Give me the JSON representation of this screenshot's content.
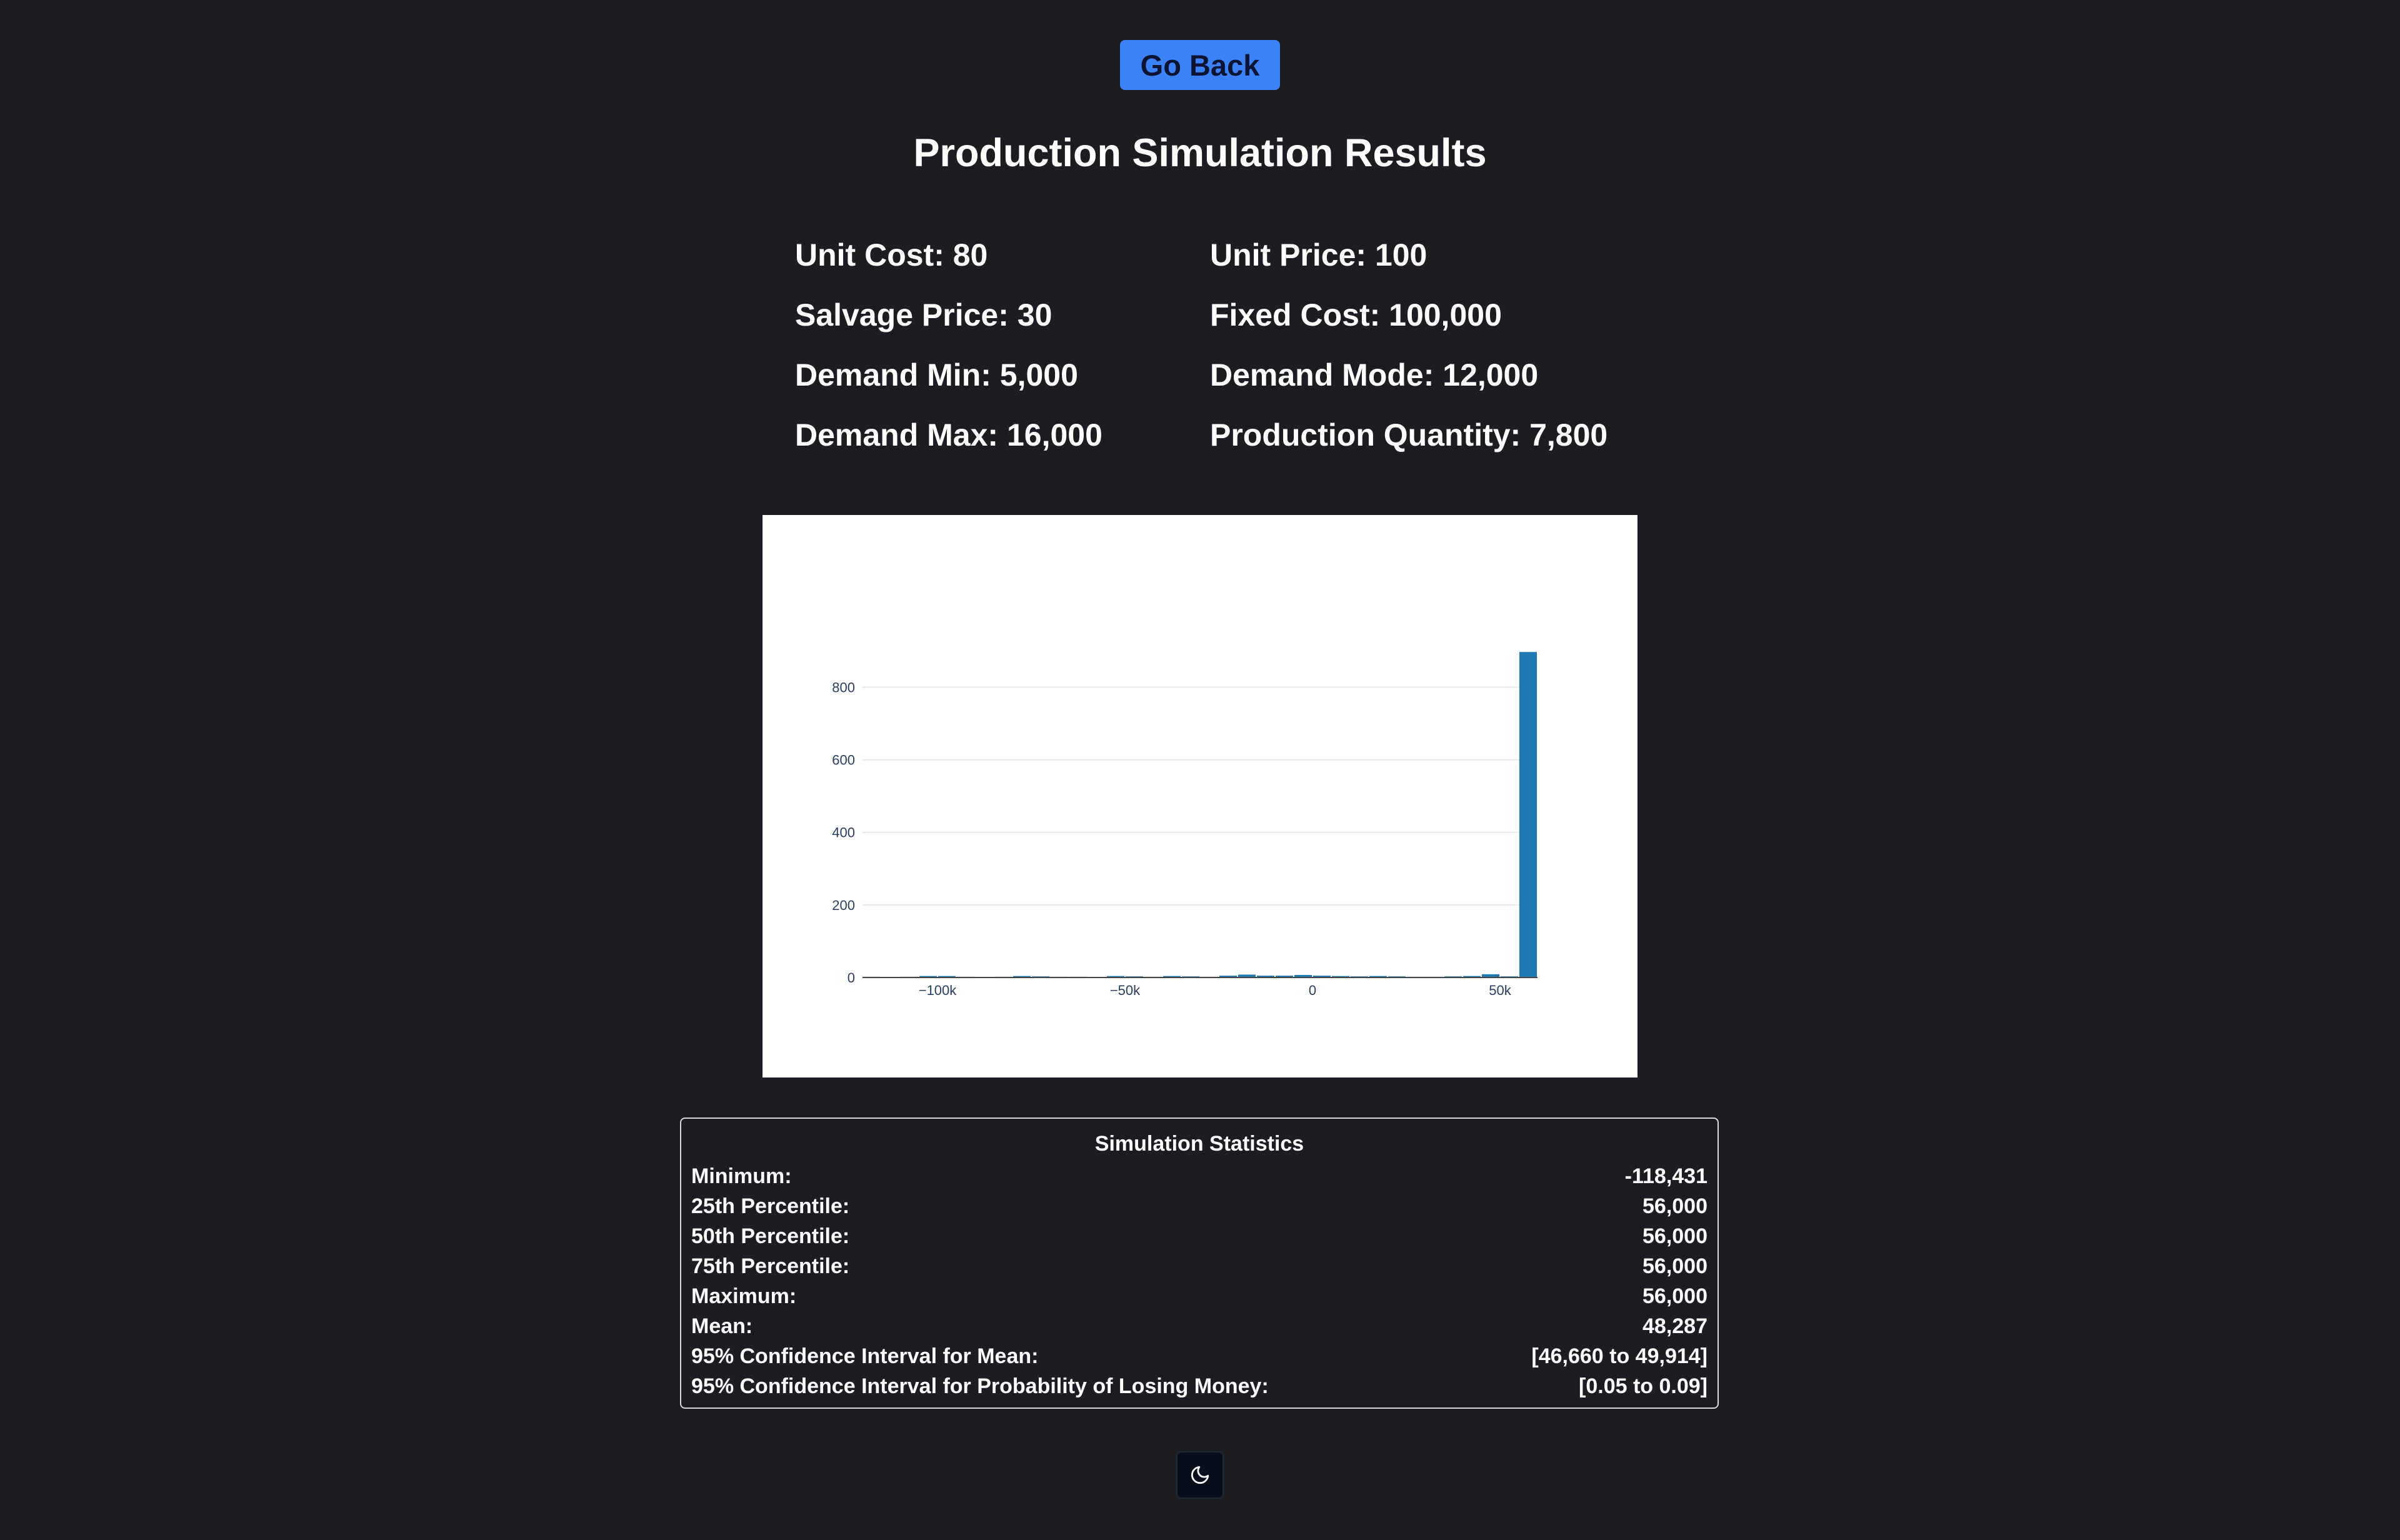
{
  "header": {
    "back_label": "Go Back"
  },
  "page_title": "Production Simulation Results",
  "params": [
    {
      "label": "Unit Cost: 80"
    },
    {
      "label": "Unit Price: 100"
    },
    {
      "label": "Salvage Price: 30"
    },
    {
      "label": "Fixed Cost: 100,000"
    },
    {
      "label": "Demand Min: 5,000"
    },
    {
      "label": "Demand Mode: 12,000"
    },
    {
      "label": "Demand Max: 16,000"
    },
    {
      "label": "Production Quantity: 7,800"
    }
  ],
  "chart_data": {
    "type": "bar",
    "title": "",
    "xlabel": "",
    "ylabel": "",
    "bar_color": "#1f77b4",
    "grid": true,
    "xlim": [
      -120000,
      60000
    ],
    "ylim": [
      0,
      930
    ],
    "x_ticks": [
      -100000,
      -50000,
      0,
      50000
    ],
    "x_tick_labels": [
      "−100k",
      "−50k",
      "0",
      "50k"
    ],
    "y_ticks": [
      0,
      200,
      400,
      600,
      800
    ],
    "y_tick_labels": [
      "0",
      "200",
      "400",
      "600",
      "800"
    ],
    "bin_width": 5000,
    "bins": [
      {
        "x": -117500,
        "y": 2
      },
      {
        "x": -112500,
        "y": 1
      },
      {
        "x": -107500,
        "y": 2
      },
      {
        "x": -102500,
        "y": 4
      },
      {
        "x": -97500,
        "y": 4
      },
      {
        "x": -92500,
        "y": 2
      },
      {
        "x": -87500,
        "y": 1
      },
      {
        "x": -82500,
        "y": 2
      },
      {
        "x": -77500,
        "y": 4
      },
      {
        "x": -72500,
        "y": 3
      },
      {
        "x": -67500,
        "y": 2
      },
      {
        "x": -62500,
        "y": 2
      },
      {
        "x": -57500,
        "y": 1
      },
      {
        "x": -52500,
        "y": 4
      },
      {
        "x": -47500,
        "y": 3
      },
      {
        "x": -42500,
        "y": 2
      },
      {
        "x": -37500,
        "y": 4
      },
      {
        "x": -32500,
        "y": 3
      },
      {
        "x": -27500,
        "y": 2
      },
      {
        "x": -22500,
        "y": 5
      },
      {
        "x": -17500,
        "y": 8
      },
      {
        "x": -12500,
        "y": 5
      },
      {
        "x": -7500,
        "y": 5
      },
      {
        "x": -2500,
        "y": 7
      },
      {
        "x": 2500,
        "y": 5
      },
      {
        "x": 7500,
        "y": 4
      },
      {
        "x": 12500,
        "y": 3
      },
      {
        "x": 17500,
        "y": 4
      },
      {
        "x": 22500,
        "y": 3
      },
      {
        "x": 27500,
        "y": 2
      },
      {
        "x": 32500,
        "y": 2
      },
      {
        "x": 37500,
        "y": 3
      },
      {
        "x": 42500,
        "y": 4
      },
      {
        "x": 47500,
        "y": 9
      },
      {
        "x": 52500,
        "y": 3
      },
      {
        "x": 57500,
        "y": 897
      }
    ]
  },
  "stats": {
    "title": "Simulation Statistics",
    "rows": [
      {
        "label": "Minimum:",
        "value": "-118,431"
      },
      {
        "label": "25th Percentile:",
        "value": "56,000"
      },
      {
        "label": "50th Percentile:",
        "value": "56,000"
      },
      {
        "label": "75th Percentile:",
        "value": "56,000"
      },
      {
        "label": "Maximum:",
        "value": "56,000"
      },
      {
        "label": "Mean:",
        "value": "48,287"
      },
      {
        "label": "95% Confidence Interval for Mean:",
        "value": "[46,660 to 49,914]"
      },
      {
        "label": "95% Confidence Interval for Probability of Losing Money:",
        "value": "[0.05 to 0.09]"
      }
    ]
  },
  "theme_toggle": {
    "icon": "moon-icon"
  }
}
